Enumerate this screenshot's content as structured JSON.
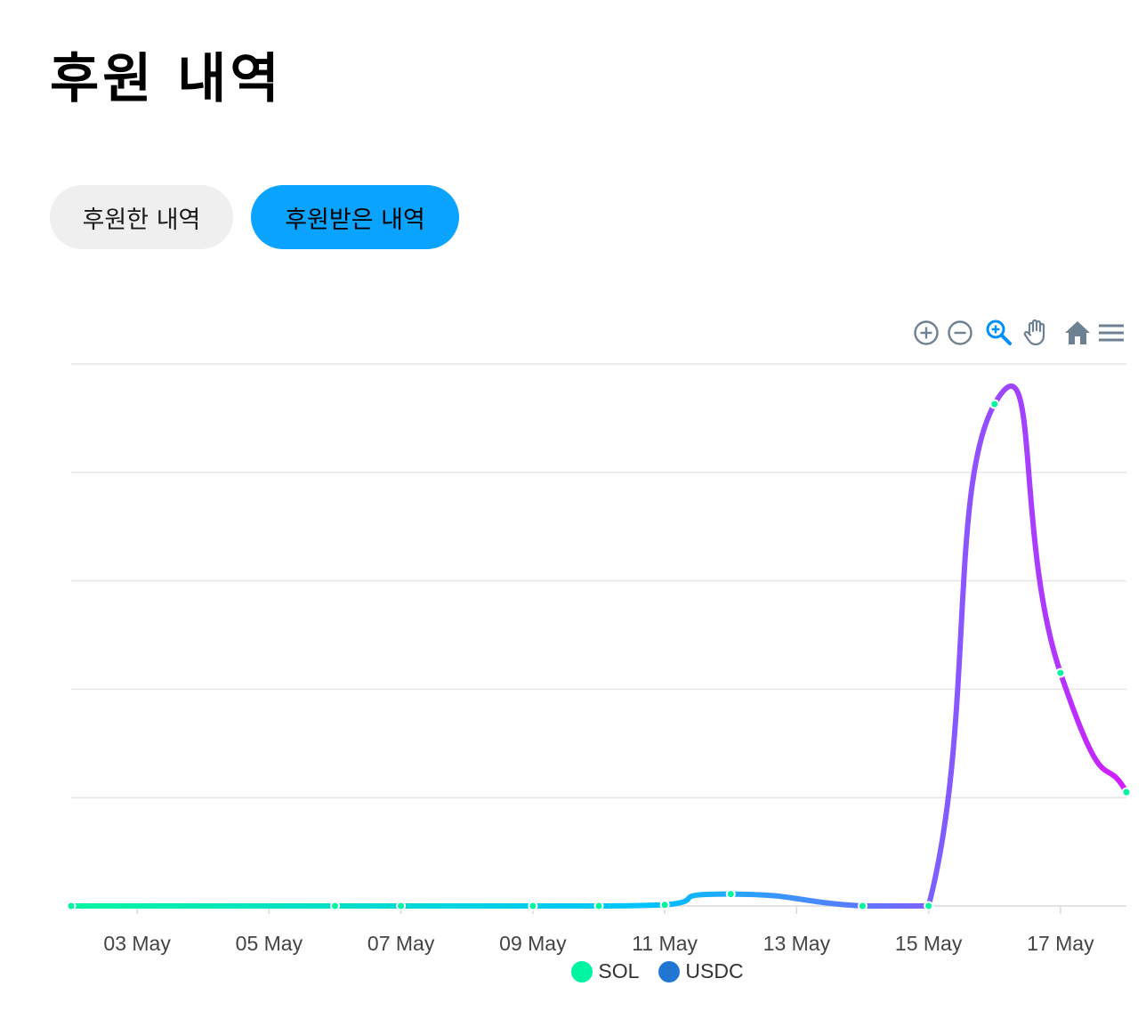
{
  "page": {
    "title": "후원 내역"
  },
  "tabs": [
    {
      "label": "후원한 내역",
      "active": false
    },
    {
      "label": "후원받은 내역",
      "active": true
    }
  ],
  "colors": {
    "accent": "#0aa3ff",
    "tab_inactive_bg": "#efefef",
    "gradient_start": "#00f5a0",
    "gradient_mid": "#00c2ff",
    "gradient_end": "#d21cff",
    "grid": "#e6e6e6",
    "marker": "#00f5a0"
  },
  "toolbar": {
    "tools": [
      {
        "name": "zoom-in-icon",
        "glyph": "plus-circle"
      },
      {
        "name": "zoom-out-icon",
        "glyph": "minus-circle"
      },
      {
        "name": "selection-zoom-icon",
        "glyph": "magnifier",
        "active": true
      },
      {
        "name": "pan-icon",
        "glyph": "hand"
      },
      {
        "name": "reset-home-icon",
        "glyph": "house"
      },
      {
        "name": "menu-icon",
        "glyph": "hamburger"
      }
    ]
  },
  "chart_data": {
    "type": "line",
    "x_type": "date",
    "title": "",
    "xlabel": "",
    "ylabel": "",
    "y_axis_labels_shown": false,
    "grid": true,
    "legend_position": "bottom",
    "xlim": [
      "2023-05-02",
      "2023-05-18"
    ],
    "ylim": [
      0,
      5
    ],
    "x_tick_labels": [
      "03 May",
      "05 May",
      "07 May",
      "09 May",
      "11 May",
      "13 May",
      "15 May",
      "17 May"
    ],
    "x_ticks": [
      "2023-05-03",
      "2023-05-05",
      "2023-05-07",
      "2023-05-09",
      "2023-05-11",
      "2023-05-13",
      "2023-05-15",
      "2023-05-17"
    ],
    "series": [
      {
        "name": "SOL",
        "color": "#00f5a0",
        "x": [
          "2023-05-02",
          "2023-05-06",
          "2023-05-07",
          "2023-05-09",
          "2023-05-10",
          "2023-05-11",
          "2023-05-12",
          "2023-05-14",
          "2023-05-15",
          "2023-05-16",
          "2023-05-17",
          "2023-05-18"
        ],
        "y": [
          0,
          0,
          0,
          0,
          0,
          0.01,
          0.11,
          0,
          0,
          4.63,
          2.15,
          1.05
        ]
      },
      {
        "name": "USDC",
        "color": "#2176d2",
        "x": [],
        "y": []
      }
    ]
  }
}
